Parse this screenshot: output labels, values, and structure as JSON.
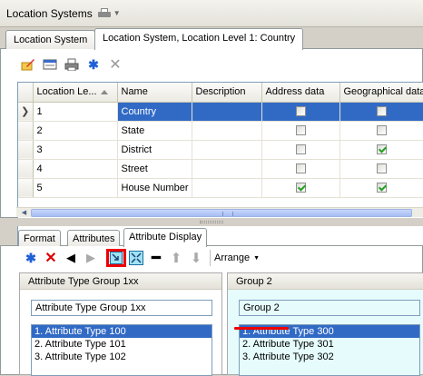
{
  "window": {
    "title": "Location Systems"
  },
  "top_tabs": [
    "Location System",
    "Location System, Location Level 1: Country"
  ],
  "grid": {
    "columns": [
      "Location Le...",
      "Name",
      "Description",
      "Address data",
      "Geographical data"
    ],
    "rows": [
      {
        "level": "1",
        "name": "Country",
        "description": "",
        "address": false,
        "geo": false,
        "selected": true
      },
      {
        "level": "2",
        "name": "State",
        "description": "",
        "address": false,
        "geo": false
      },
      {
        "level": "3",
        "name": "District",
        "description": "",
        "address": false,
        "geo": true
      },
      {
        "level": "4",
        "name": "Street",
        "description": "",
        "address": false,
        "geo": false
      },
      {
        "level": "5",
        "name": "House Number",
        "description": "",
        "address": true,
        "geo": true
      }
    ]
  },
  "bottom_tabs": [
    "Format",
    "Attributes",
    "Attribute Display"
  ],
  "toolbar2": {
    "arrange_label": "Arrange"
  },
  "groups": [
    {
      "title": "Attribute Type Group 1xx",
      "name_value": "Attribute Type Group 1xx",
      "items": [
        "1. Attribute Type 100",
        "2. Attribute Type 101",
        "3. Attribute Type 102"
      ]
    },
    {
      "title": "Group 2",
      "name_value": "Group 2",
      "items": [
        "1. Attribute Type 300",
        "2. Attribute Type 301",
        "3. Attribute Type 302"
      ]
    }
  ],
  "colors": {
    "selection": "#316ac5",
    "highlight": "#e00000",
    "cyan_group": "#e6fcfc"
  }
}
